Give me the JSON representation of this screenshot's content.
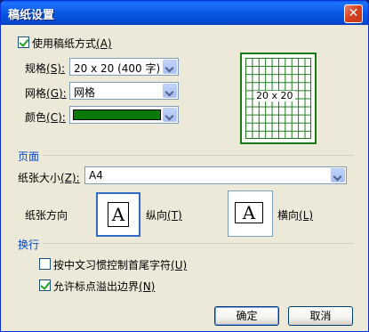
{
  "window": {
    "title": "稿纸设置",
    "close_symbol": "✕"
  },
  "use_grid_paper": {
    "label": "使用稿纸方式",
    "shortcut": "(A)",
    "checked": true
  },
  "spec": {
    "label": "规格",
    "shortcut": "(S):",
    "value": "20 x 20 (400 字)"
  },
  "grid": {
    "label": "网格",
    "shortcut": "(G):",
    "value": "网格"
  },
  "color": {
    "label": "颜色",
    "shortcut": "(C):",
    "value": "#0a7a0a"
  },
  "preview": {
    "label": "20 x 20",
    "color": "#1a7a1a"
  },
  "page_section": {
    "title": "页面",
    "paper_size_label": "纸张大小",
    "paper_size_shortcut": "(Z):",
    "paper_size_value": "A4",
    "orientation_label": "纸张方向",
    "portrait_label": "纵向",
    "portrait_shortcut": "(T)",
    "landscape_label": "横向",
    "landscape_shortcut": "(L)",
    "orient_glyph": "A"
  },
  "line_break_section": {
    "title": "换行",
    "chinese_control_label": "按中文习惯控制首尾字符",
    "chinese_control_shortcut": "(U)",
    "chinese_control_checked": false,
    "allow_overflow_label": "允许标点溢出边界",
    "allow_overflow_shortcut": "(N)",
    "allow_overflow_checked": true
  },
  "buttons": {
    "ok": "确定",
    "cancel": "取消"
  }
}
